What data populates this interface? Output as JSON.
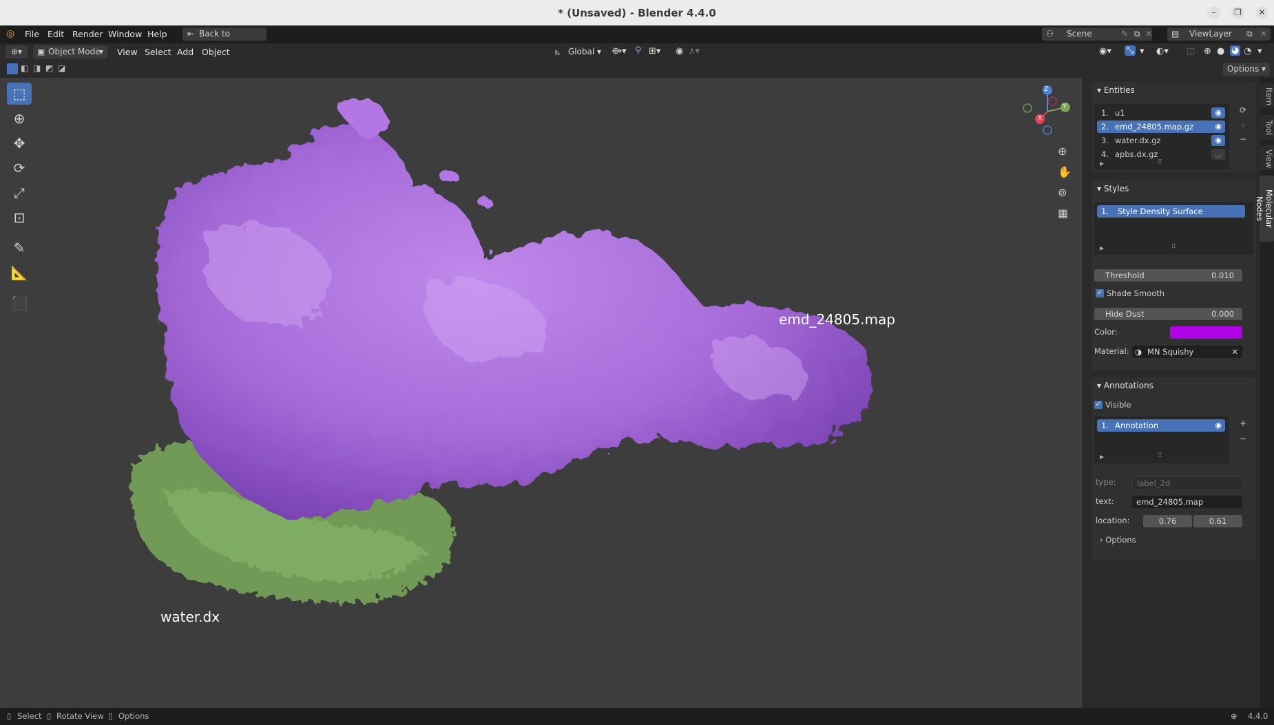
{
  "window": {
    "title": "* (Unsaved) - Blender 4.4.0"
  },
  "menu": {
    "items": [
      "File",
      "Edit",
      "Render",
      "Window",
      "Help"
    ],
    "back_button": "Back to Previous",
    "scene": "Scene",
    "view_layer": "ViewLayer"
  },
  "header": {
    "mode": "Object Mode",
    "menus": [
      "View",
      "Select",
      "Add",
      "Object"
    ],
    "transform_orientation": "Global",
    "options": "Options"
  },
  "viewport": {
    "labels": {
      "map": "emd_24805.map",
      "water": "water.dx"
    },
    "gizmo": {
      "x": "X",
      "y": "Y",
      "z": "Z"
    },
    "colors": {
      "map": "#a66ad8",
      "water": "#6f9a55",
      "background": "#3d3d3d"
    }
  },
  "sidebar": {
    "tabs": [
      "Item",
      "Tool",
      "View",
      "Molecular Nodes"
    ],
    "entities": {
      "title": "Entities",
      "items": [
        {
          "index": "1.",
          "name": "u1",
          "visible": true
        },
        {
          "index": "2.",
          "name": "emd_24805.map.gz",
          "visible": true,
          "selected": true
        },
        {
          "index": "3.",
          "name": "water.dx.gz",
          "visible": true
        },
        {
          "index": "4.",
          "name": "apbs.dx.gz",
          "visible": false
        }
      ]
    },
    "styles": {
      "title": "Styles",
      "items": [
        {
          "index": "1.",
          "name": "Style Density Surface"
        }
      ],
      "threshold_label": "Threshold",
      "threshold_value": "0.010",
      "shade_smooth": "Shade Smooth",
      "hide_dust_label": "Hide Dust",
      "hide_dust_value": "0.000",
      "color_label": "Color:",
      "color_value": "#b000e6",
      "material_label": "Material:",
      "material_value": "MN Squishy"
    },
    "annotations": {
      "title": "Annotations",
      "visible_label": "Visible",
      "items": [
        {
          "index": "1.",
          "name": "Annotation"
        }
      ],
      "type_label": "type:",
      "type_value": "label_2d",
      "text_label": "text:",
      "text_value": "emd_24805.map",
      "location_label": "location:",
      "location_x": "0.76",
      "location_y": "0.61",
      "options_label": "Options"
    }
  },
  "status": {
    "select": "Select",
    "rotate": "Rotate View",
    "options": "Options",
    "version": "4.4.0"
  }
}
